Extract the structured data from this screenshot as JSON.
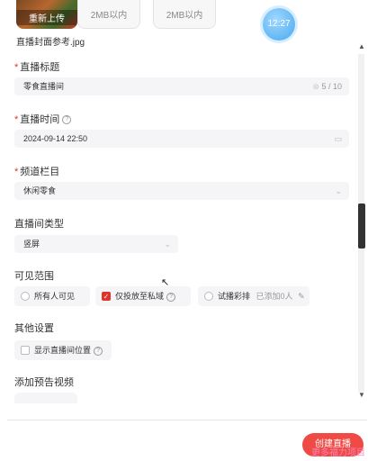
{
  "cover": {
    "reupload_label": "重新上传",
    "limit_1": "2MB以内",
    "limit_2": "2MB以内",
    "filename": "直播封面参考.jpg",
    "bubble_time": "12:27"
  },
  "title_field": {
    "label": "直播标题",
    "required": "*",
    "value": "零食直播间",
    "counter": "5 / 10"
  },
  "time_field": {
    "label": "直播时间",
    "required": "*",
    "value": "2024-09-14 22:50"
  },
  "channel_field": {
    "label": "频道栏目",
    "required": "*",
    "value": "休闲零食"
  },
  "room_type": {
    "label": "直播间类型",
    "value": "竖屏"
  },
  "visibility": {
    "label": "可见范围",
    "opt_all": "所有人可见",
    "opt_private": "仅投放至私域",
    "opt_test": "试播彩排",
    "added": "已添加0人"
  },
  "other": {
    "label": "其他设置",
    "show_location": "显示直播间位置"
  },
  "preview_video": {
    "label": "添加预告视频"
  },
  "footer": {
    "create_label": "创建直播",
    "watermark": "更多福力项目"
  },
  "colors": {
    "accent": "#e0322b",
    "button": "#ef4a43"
  }
}
